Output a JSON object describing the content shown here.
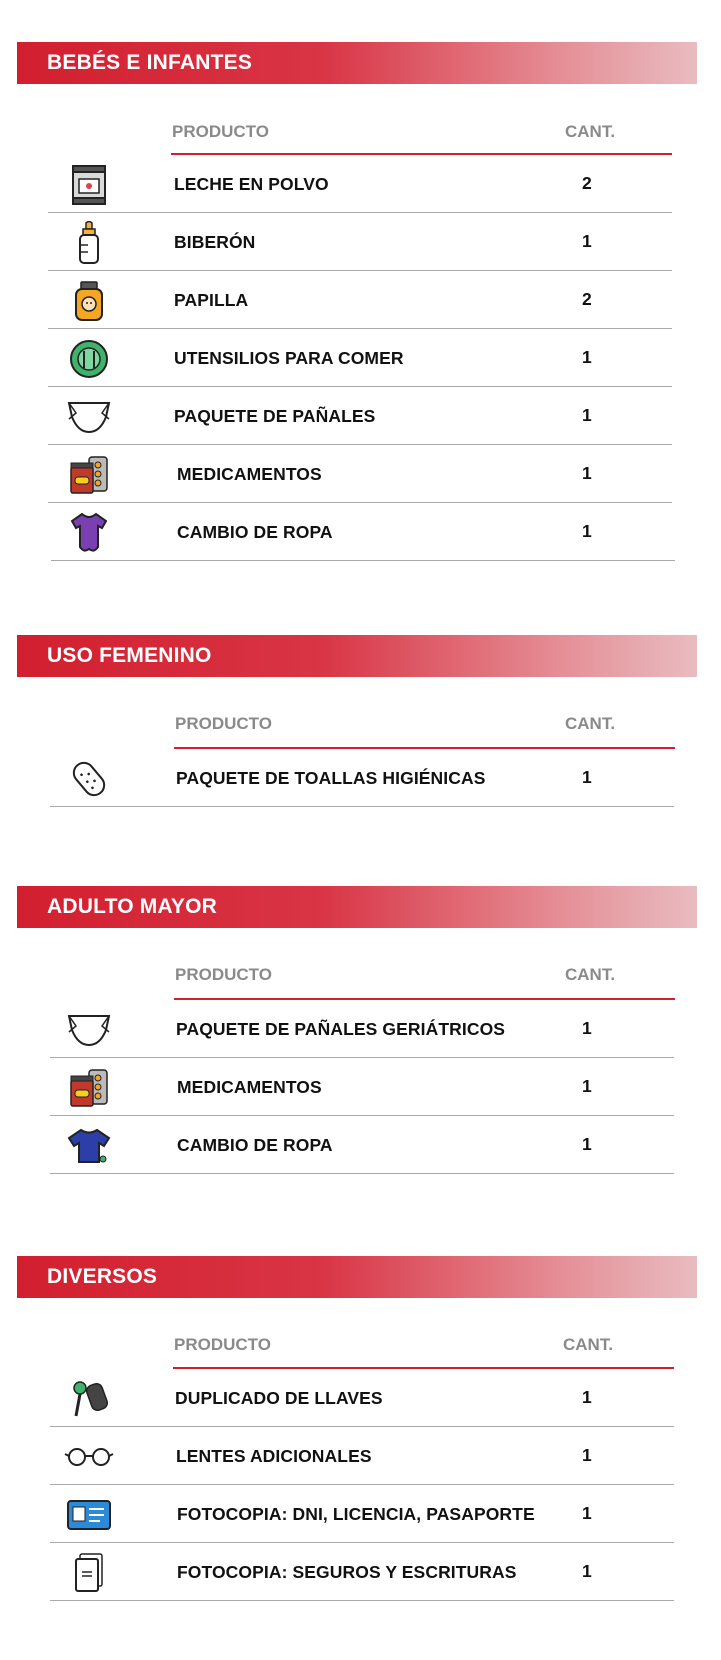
{
  "sections": [
    {
      "title": "BEBÉS E INFANTES",
      "col_product": "PRODUCTO",
      "col_qty": "CANT.",
      "items": [
        {
          "icon": "milk-powder-can-icon",
          "name": "LECHE EN POLVO",
          "qty": "2"
        },
        {
          "icon": "baby-bottle-icon",
          "name": "BIBERÓN",
          "qty": "1"
        },
        {
          "icon": "baby-food-jar-icon",
          "name": "PAPILLA",
          "qty": "2"
        },
        {
          "icon": "eating-utensils-icon",
          "name": "UTENSILIOS PARA COMER",
          "qty": "1"
        },
        {
          "icon": "diaper-icon",
          "name": "PAQUETE DE PAÑALES",
          "qty": "1"
        },
        {
          "icon": "medicine-icon",
          "name": "MEDICAMENTOS",
          "qty": "1"
        },
        {
          "icon": "baby-onesie-icon",
          "name": "CAMBIO DE ROPA",
          "qty": "1"
        }
      ]
    },
    {
      "title": "USO FEMENINO",
      "col_product": "PRODUCTO",
      "col_qty": "CANT.",
      "items": [
        {
          "icon": "sanitary-pad-icon",
          "name": "PAQUETE DE TOALLAS HIGIÉNICAS",
          "qty": "1"
        }
      ]
    },
    {
      "title": "ADULTO MAYOR",
      "col_product": "PRODUCTO",
      "col_qty": "CANT.",
      "items": [
        {
          "icon": "diaper-icon",
          "name": "PAQUETE DE PAÑALES GERIÁTRICOS",
          "qty": "1"
        },
        {
          "icon": "medicine-icon",
          "name": "MEDICAMENTOS",
          "qty": "1"
        },
        {
          "icon": "adult-shirt-icon",
          "name": "CAMBIO DE ROPA",
          "qty": "1"
        }
      ]
    },
    {
      "title": "DIVERSOS",
      "col_product": "PRODUCTO",
      "col_qty": "CANT.",
      "items": [
        {
          "icon": "keys-icon",
          "name": "DUPLICADO DE LLAVES",
          "qty": "1"
        },
        {
          "icon": "glasses-icon",
          "name": "LENTES ADICIONALES",
          "qty": "1"
        },
        {
          "icon": "id-card-icon",
          "name": "FOTOCOPIA: DNI, LICENCIA, PASAPORTE",
          "qty": "1"
        },
        {
          "icon": "document-copy-icon",
          "name": "FOTOCOPIA: SEGUROS Y ESCRITURAS",
          "qty": "1"
        }
      ]
    }
  ],
  "colors": {
    "accent": "#d21f2f",
    "rule": "#a9a9a9",
    "header_text": "#8a8a8a"
  }
}
